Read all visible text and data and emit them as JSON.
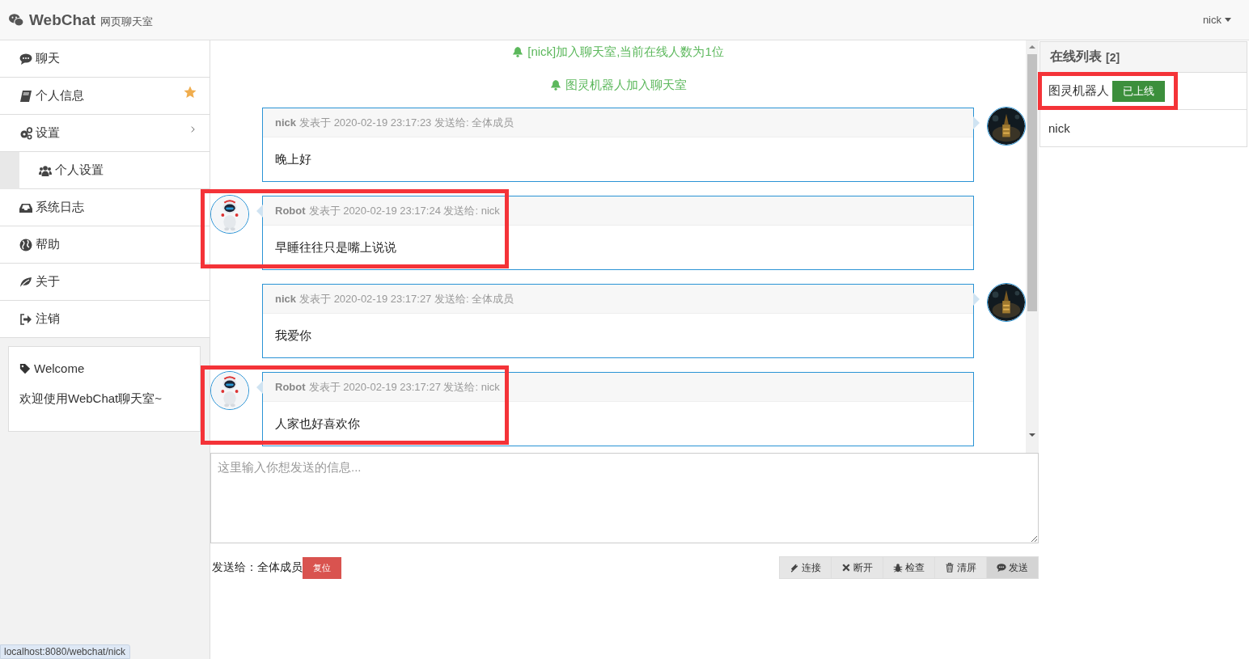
{
  "header": {
    "logo": "WebChat",
    "subtitle": "网页聊天室",
    "user_menu": "nick"
  },
  "sidebar": {
    "items": [
      {
        "label": "聊天",
        "starred": false,
        "selected": false
      },
      {
        "label": "个人信息",
        "starred": true,
        "selected": false
      },
      {
        "label": "设置",
        "starred": false,
        "selected": false,
        "children": [
          {
            "label": "个人设置",
            "starred": false,
            "selected": false
          }
        ]
      },
      {
        "label": "系统日志",
        "starred": false,
        "selected": false
      },
      {
        "label": "帮助",
        "starred": false,
        "selected": false
      },
      {
        "label": "关于",
        "starred": false,
        "selected": false
      },
      {
        "label": "注销",
        "starred": false,
        "selected": false
      }
    ]
  },
  "welcome": {
    "title": "Welcome",
    "text": "欢迎使用WebChat聊天室~"
  },
  "notices": [
    "[nick]加入聊天室,当前在线人数为1位",
    "图灵机器人加入聊天室"
  ],
  "messages": [
    {
      "kind": "sent",
      "sender": "nick",
      "meta": "发表于 2020-02-19 23:17:23 发送给: 全体成员",
      "text": "晚上好",
      "highlighted": false
    },
    {
      "kind": "received",
      "sender": "Robot",
      "meta": "发表于 2020-02-19 23:17:24 发送给: nick",
      "text": "早睡往往只是嘴上说说",
      "highlighted": true
    },
    {
      "kind": "sent",
      "sender": "nick",
      "meta": "发表于 2020-02-19 23:17:27 发送给: 全体成员",
      "text": "我爱你",
      "highlighted": false
    },
    {
      "kind": "received",
      "sender": "Robot",
      "meta": "发表于 2020-02-19 23:17:27 发送给: nick",
      "text": "人家也好喜欢你",
      "highlighted": true
    }
  ],
  "composer": {
    "placeholder": "这里输入你想发送的信息...",
    "send_to": "发送给：全体成员",
    "reset_button": "复位",
    "buttons": [
      {
        "label": "连接",
        "selected": false
      },
      {
        "label": "断开",
        "selected": false
      },
      {
        "label": "检查",
        "selected": false
      },
      {
        "label": "清屏",
        "selected": false
      },
      {
        "label": "发送",
        "selected": true
      }
    ]
  },
  "online": {
    "title": "在线列表",
    "count": "[2]",
    "users": [
      {
        "name": "图灵机器人",
        "badge": "已上线",
        "highlighted": true
      },
      {
        "name": "nick",
        "highlighted": false
      }
    ]
  },
  "status_bar": "localhost:8080/webchat/nick"
}
